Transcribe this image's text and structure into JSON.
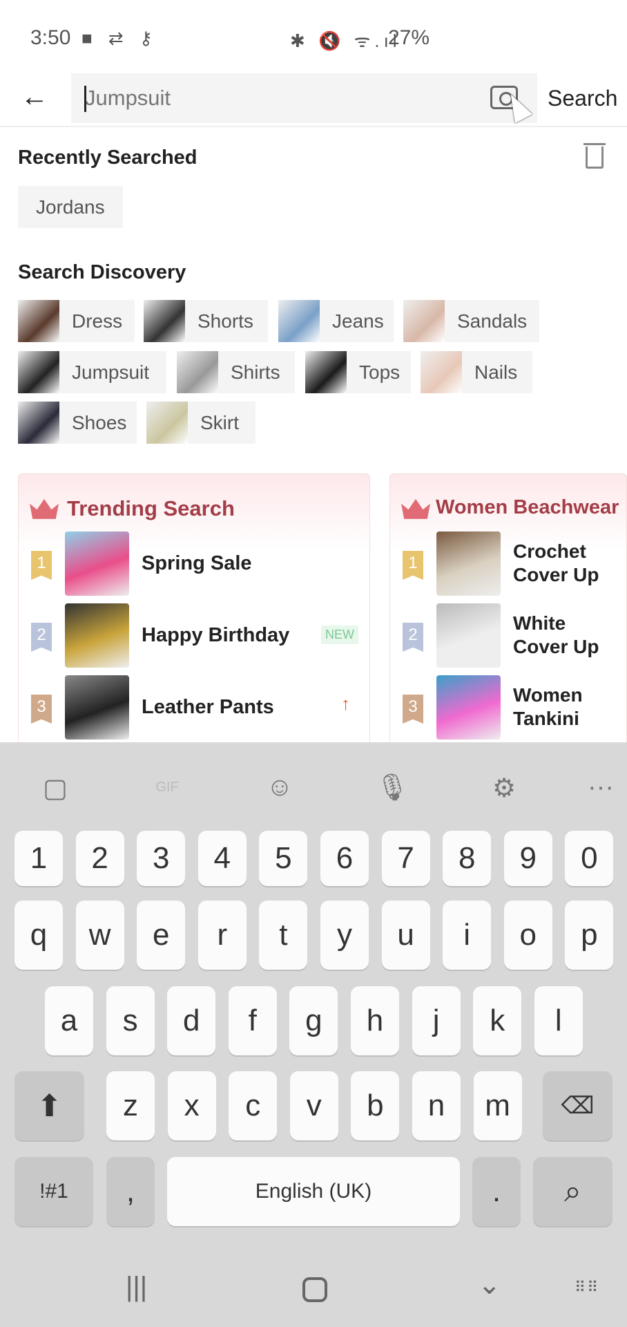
{
  "status": {
    "time": "3:50",
    "battery": "27%",
    "left_icons": "■ ⇄ ⚷",
    "right_icons": "✱ 🔇 ᯤ.ıl"
  },
  "search": {
    "value": "Jumpsuit",
    "button": "Search"
  },
  "recent": {
    "title": "Recently Searched",
    "items": [
      "Jordans"
    ]
  },
  "discovery": {
    "title": "Search Discovery",
    "items": [
      "Dress",
      "Shorts",
      "Jeans",
      "Sandals",
      "Jumpsuit",
      "Shirts",
      "Tops",
      "Nails",
      "Shoes",
      "Skirt"
    ]
  },
  "cards": [
    {
      "title": "Trending Search",
      "items": [
        {
          "rank": "1",
          "name": "Spring Sale"
        },
        {
          "rank": "2",
          "name": "Happy Birthday",
          "badge": "NEW"
        },
        {
          "rank": "3",
          "name": "Leather Pants",
          "trend": "up"
        }
      ]
    },
    {
      "title": "Women Beachwear",
      "items": [
        {
          "rank": "1",
          "name": "Crochet Cover Up"
        },
        {
          "rank": "2",
          "name": "White Cover Up"
        },
        {
          "rank": "3",
          "name": "Women Tankini"
        }
      ]
    }
  ],
  "keyboard": {
    "toolbar": [
      "sticker-icon",
      "gif-icon",
      "emoji-icon",
      "mic-icon",
      "settings-icon",
      "more-icon"
    ],
    "gif_label": "GIF",
    "numbers": [
      "1",
      "2",
      "3",
      "4",
      "5",
      "6",
      "7",
      "8",
      "9",
      "0"
    ],
    "row1": [
      "q",
      "w",
      "e",
      "r",
      "t",
      "y",
      "u",
      "i",
      "o",
      "p"
    ],
    "row2": [
      "a",
      "s",
      "d",
      "f",
      "g",
      "h",
      "j",
      "k",
      "l"
    ],
    "row3": [
      "z",
      "x",
      "c",
      "v",
      "b",
      "n",
      "m"
    ],
    "symbols": "!#1",
    "comma": ",",
    "space": "English (UK)",
    "period": "."
  },
  "colors": {
    "accent": "#a33d47",
    "rank1": "#e8c46f",
    "rank2": "#b9c3dc",
    "rank3": "#cfa98a"
  }
}
